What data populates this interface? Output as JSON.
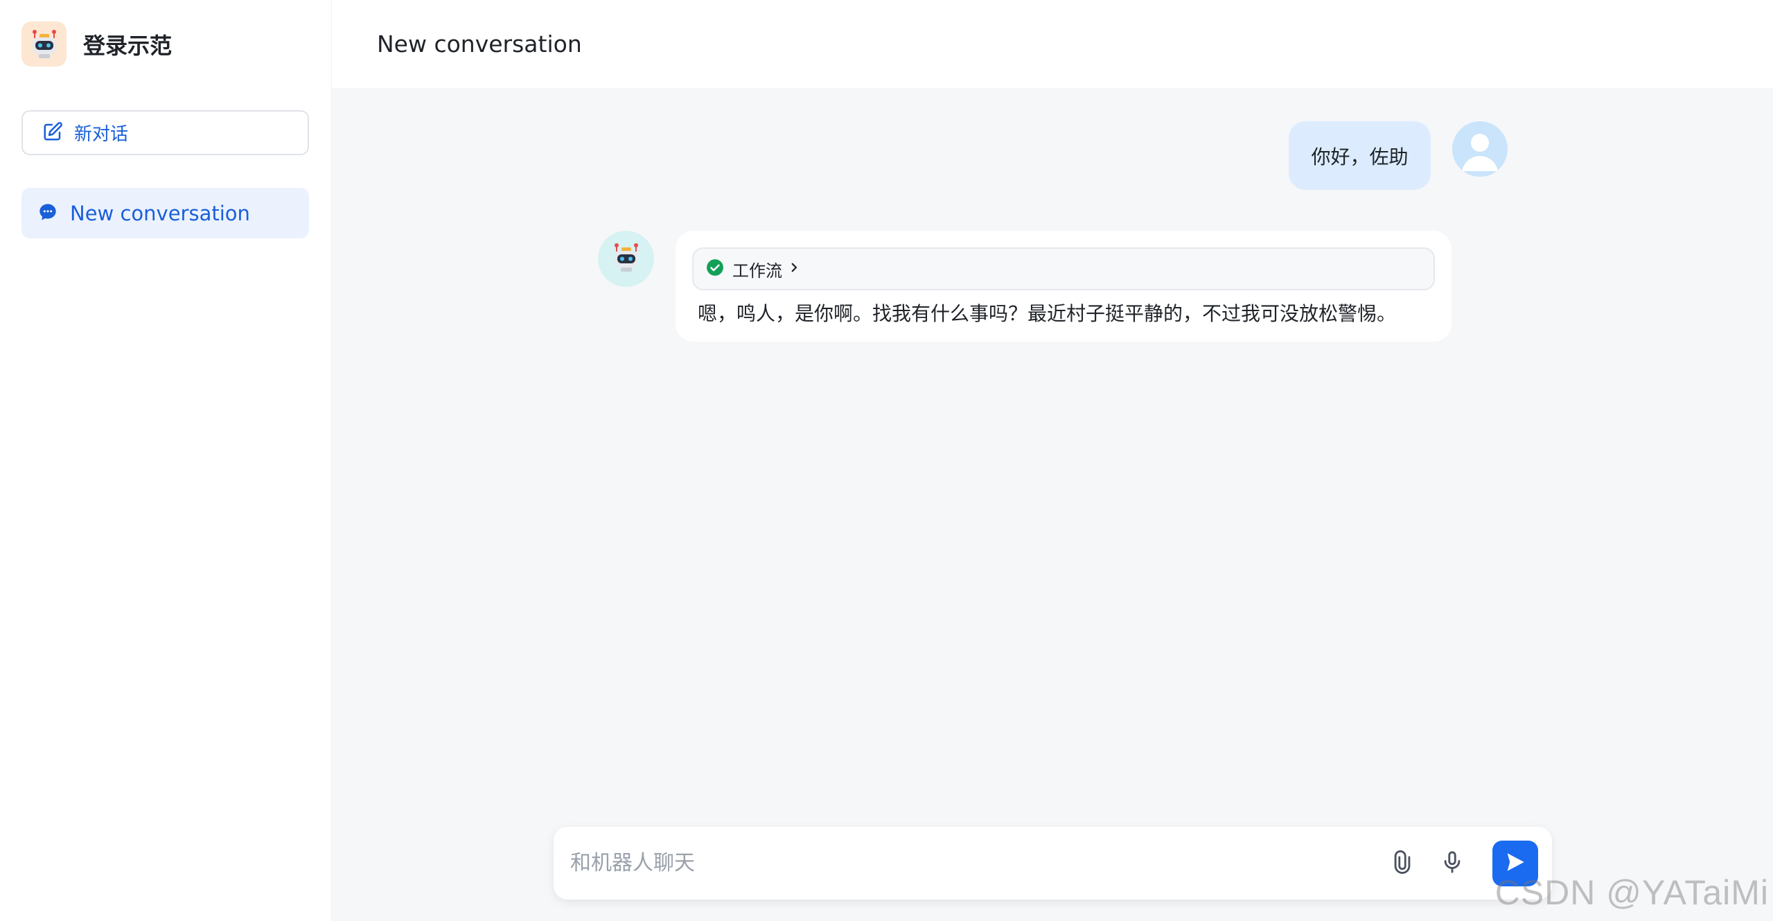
{
  "sidebar": {
    "brand_title": "登录示范",
    "new_chat_label": "新对话",
    "conversations": [
      {
        "label": "New conversation",
        "active": true
      }
    ]
  },
  "main": {
    "header_title": "New conversation",
    "messages": [
      {
        "role": "user",
        "text": "你好，佐助"
      },
      {
        "role": "bot",
        "workflow_label": "工作流",
        "text": "嗯，鸣人，是你啊。找我有什么事吗？最近村子挺平静的，不过我可没放松警惕。"
      }
    ]
  },
  "composer": {
    "placeholder": "和机器人聊天",
    "value": ""
  },
  "watermark": "CSDN @YATaiMi",
  "colors": {
    "accent": "#1a6bf0",
    "accent_text": "#1a5fd9",
    "active_item_bg": "#ebf2fe",
    "user_bubble": "#dcecfe",
    "success": "#12a058"
  },
  "icons": {
    "brand": "robot-icon",
    "new_chat": "edit-icon",
    "conversation": "chat-bubble-icon",
    "workflow_status": "check-circle-icon",
    "workflow_expand": "chevron-right-icon",
    "attach": "paperclip-icon",
    "mic": "microphone-icon",
    "send": "send-icon",
    "user_avatar": "user-avatar-icon",
    "bot_avatar": "robot-icon"
  }
}
